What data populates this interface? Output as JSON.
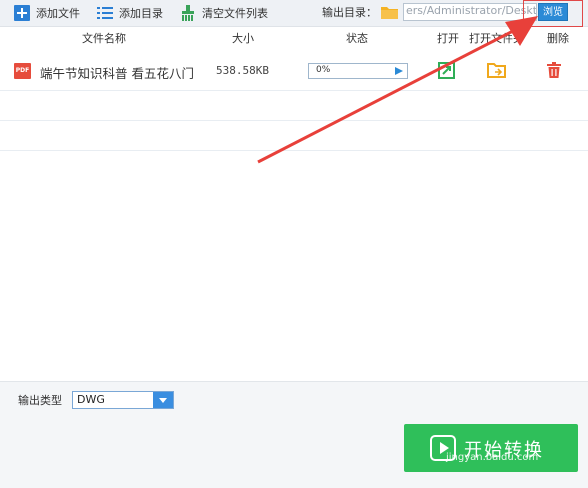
{
  "toolbar": {
    "add_file": "添加文件",
    "add_dir": "添加目录",
    "clear_list": "清空文件列表",
    "output_dir_label": "输出目录：",
    "output_path": "ers/Administrator/Desktop",
    "browse": "浏览"
  },
  "table": {
    "headers": {
      "name": "文件名称",
      "size": "大小",
      "status": "状态",
      "open": "打开",
      "open_folder": "打开文件夹",
      "delete": "删除"
    },
    "rows": [
      {
        "icon_label": "PDF",
        "name": "端午节知识科普 看五花八门",
        "size": "538.58KB",
        "progress": "0%"
      }
    ]
  },
  "bottom": {
    "output_type_label": "输出类型",
    "output_type_value": "DWG",
    "start_text": "开始转换",
    "watermark": "jingyan.baidu.com"
  },
  "colors": {
    "accent": "#2b8ad6",
    "green": "#2fbf5a",
    "annotation": "#e04848"
  }
}
